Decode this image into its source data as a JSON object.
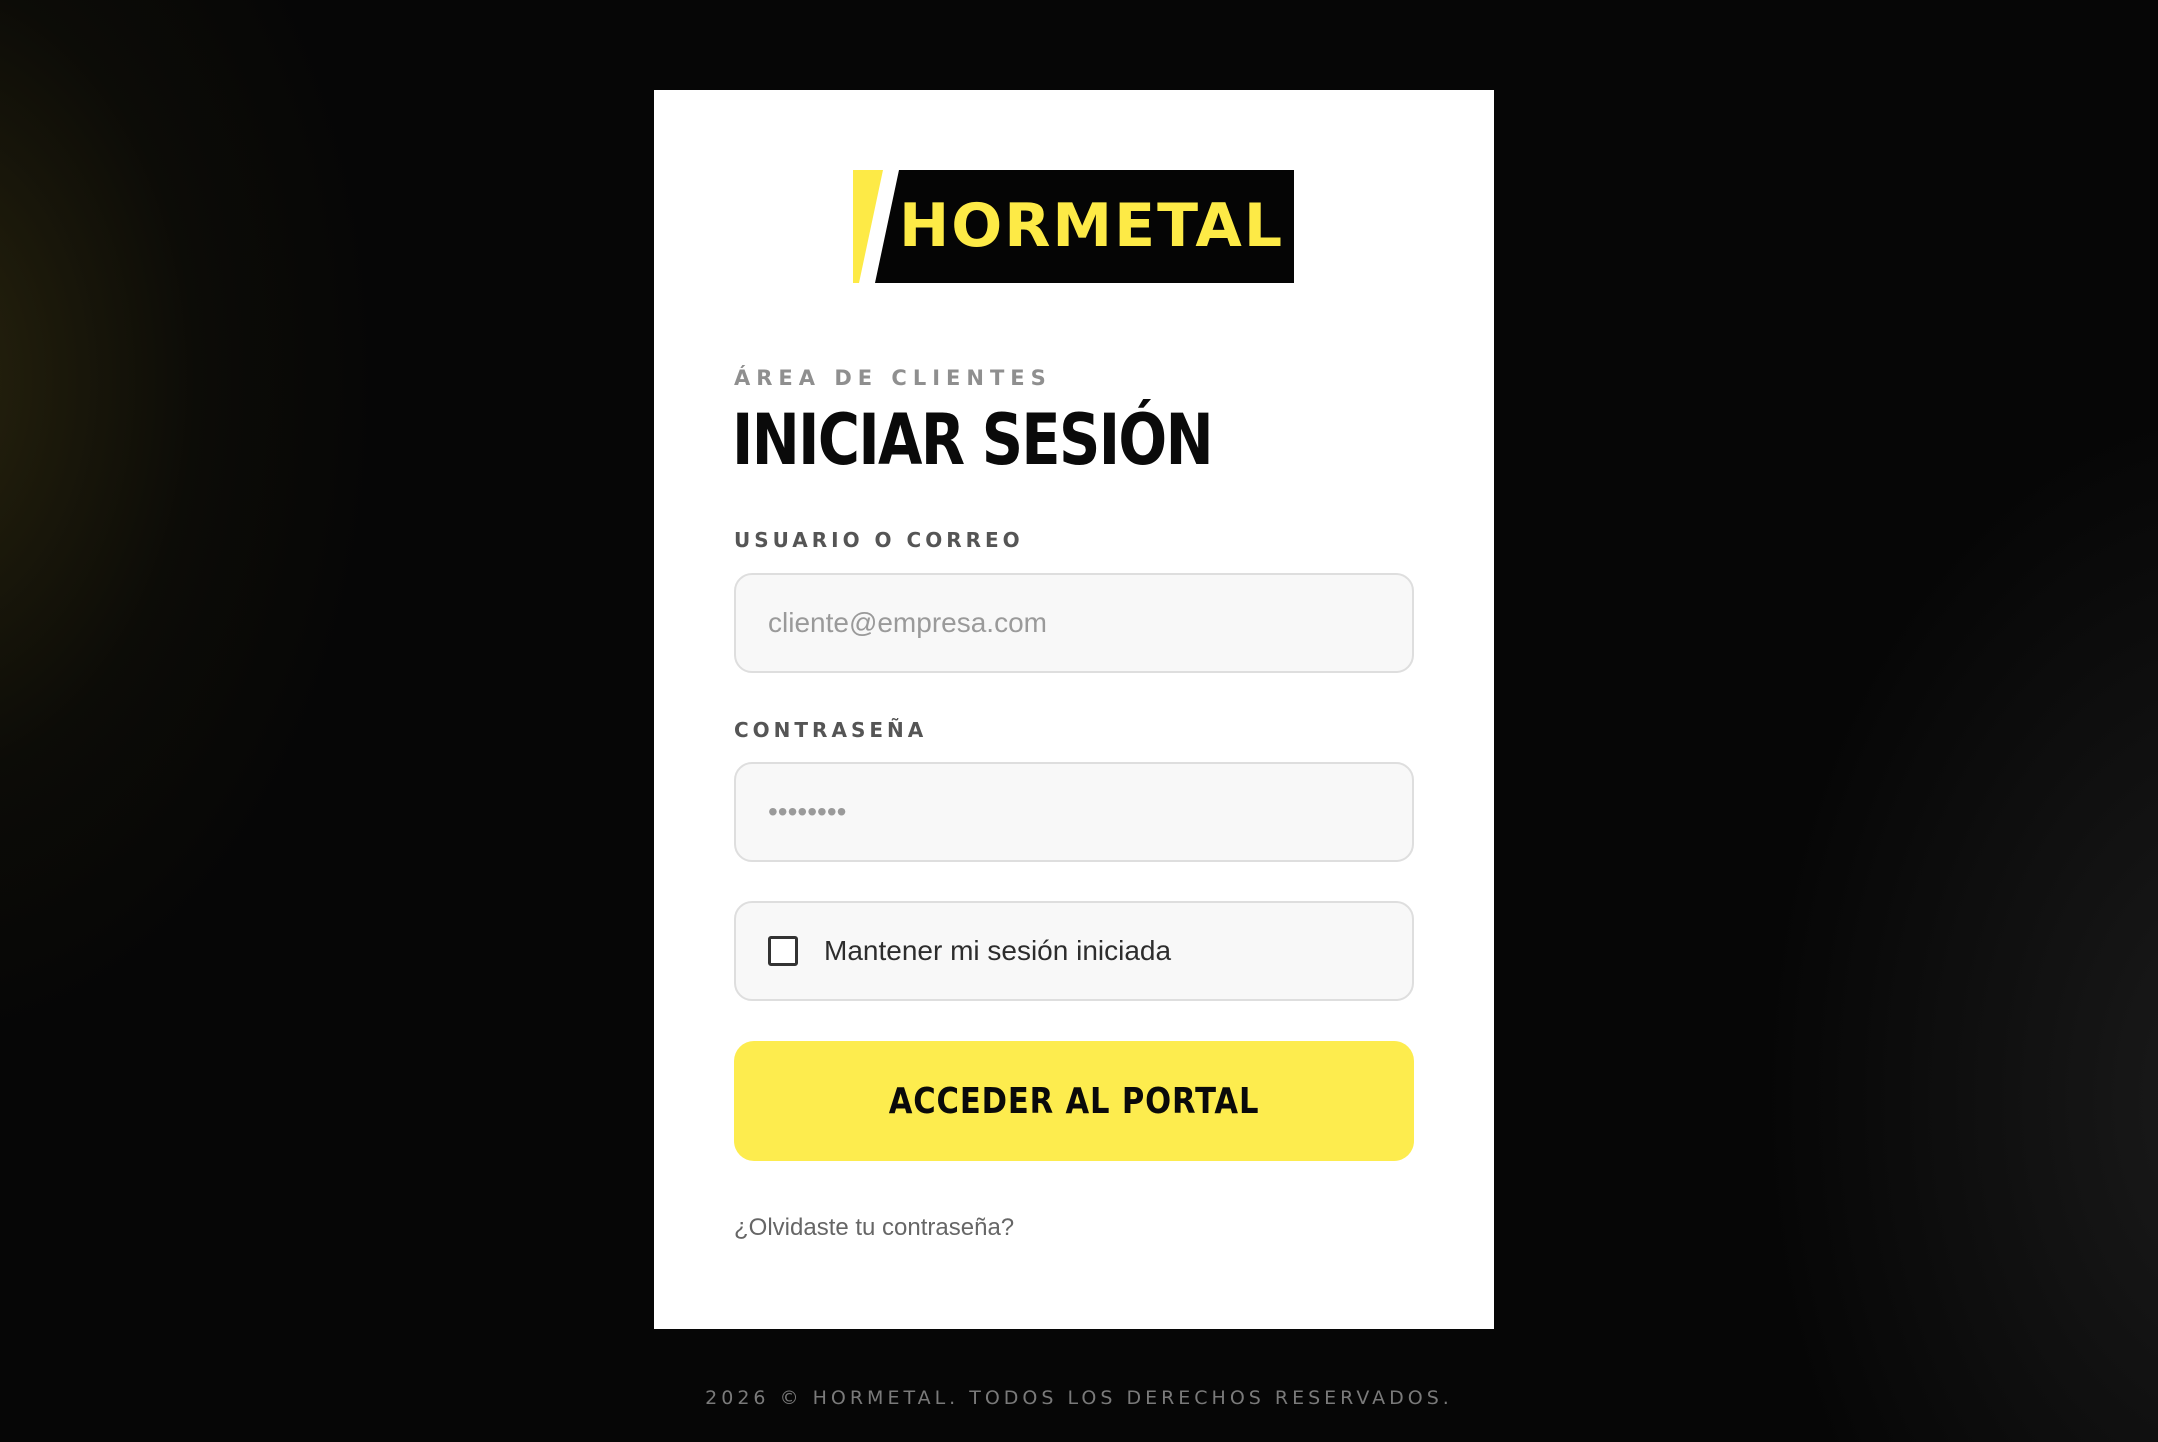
{
  "brand": {
    "logo_text": "HORMETAL",
    "colors": {
      "accent_yellow": "#fdec4e",
      "logo_black": "#050505",
      "logo_yellow": "#fdea46"
    }
  },
  "login": {
    "eyebrow": "ÁREA DE CLIENTES",
    "title": "INICIAR SESIÓN",
    "username": {
      "label": "USUARIO O CORREO",
      "placeholder": "cliente@empresa.com",
      "value": ""
    },
    "password": {
      "label": "CONTRASEÑA",
      "placeholder": "••••••••",
      "value": ""
    },
    "remember": {
      "label": "Mantener mi sesión iniciada",
      "checked": false
    },
    "submit_label": "ACCEDER AL PORTAL",
    "forgot_link": "¿Olvidaste tu contraseña?"
  },
  "footer": {
    "text": "2026 © HORMETAL. TODOS LOS DERECHOS RESERVADOS."
  }
}
